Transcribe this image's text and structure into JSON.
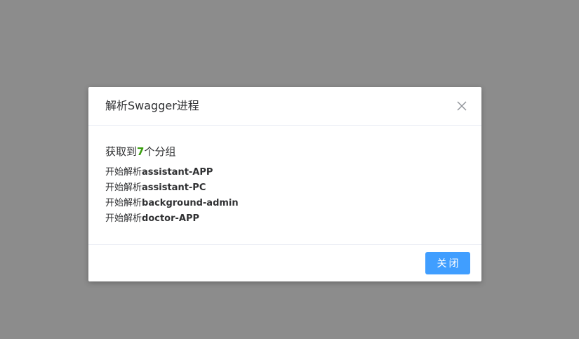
{
  "dialog": {
    "title": "解析Swagger进程",
    "close_icon": "close-icon",
    "summary": {
      "prefix": "获取到",
      "count": "7",
      "suffix": "个分组"
    },
    "log": [
      {
        "prefix": "开始解析",
        "group": "assistant-APP"
      },
      {
        "prefix": "开始解析",
        "group": "assistant-PC"
      },
      {
        "prefix": "开始解析",
        "group": "background-admin"
      },
      {
        "prefix": "开始解析",
        "group": "doctor-APP"
      }
    ],
    "footer": {
      "close_label": "关闭"
    }
  },
  "colors": {
    "overlay": "#8c8c8c",
    "primary": "#409eff",
    "count_highlight": "#389e0d"
  }
}
